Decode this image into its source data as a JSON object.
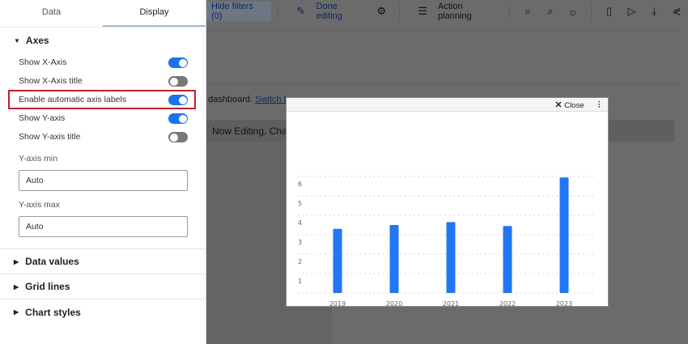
{
  "toolbar": {
    "hide_filters": "Hide filters (0)",
    "done_editing": "Done editing",
    "action_planning": "Action planning"
  },
  "notice": {
    "text": "dashboard.",
    "link": "Switch ba"
  },
  "editing_bar": "Now Editing. Chan",
  "sidebar": {
    "tabs": [
      {
        "label": "Data"
      },
      {
        "label": "Display"
      }
    ],
    "axes": {
      "title": "Axes",
      "toggles": [
        {
          "label": "Show X-Axis",
          "on": true
        },
        {
          "label": "Show X-Axis title",
          "on": false
        },
        {
          "label": "Enable automatic axis labels",
          "on": true
        },
        {
          "label": "Show Y-axis",
          "on": true
        },
        {
          "label": "Show Y-axis title",
          "on": false
        }
      ],
      "ymin_label": "Y-axis min",
      "ymin_value": "Auto",
      "ymax_label": "Y-axis max",
      "ymax_value": "Auto"
    },
    "sections": [
      "Data values",
      "Grid lines",
      "Chart styles"
    ]
  },
  "modal": {
    "close_label": "Close"
  },
  "chart_data": {
    "type": "bar",
    "categories": [
      "2019",
      "2020",
      "2021",
      "2022",
      "2023"
    ],
    "values": [
      3.3,
      3.5,
      3.65,
      3.45,
      5.95
    ],
    "yticks": [
      1,
      2,
      3,
      4,
      5,
      6
    ],
    "ylim": [
      0,
      6
    ],
    "grid": true,
    "color": "#2176f5",
    "title": "",
    "xlabel": "",
    "ylabel": ""
  }
}
